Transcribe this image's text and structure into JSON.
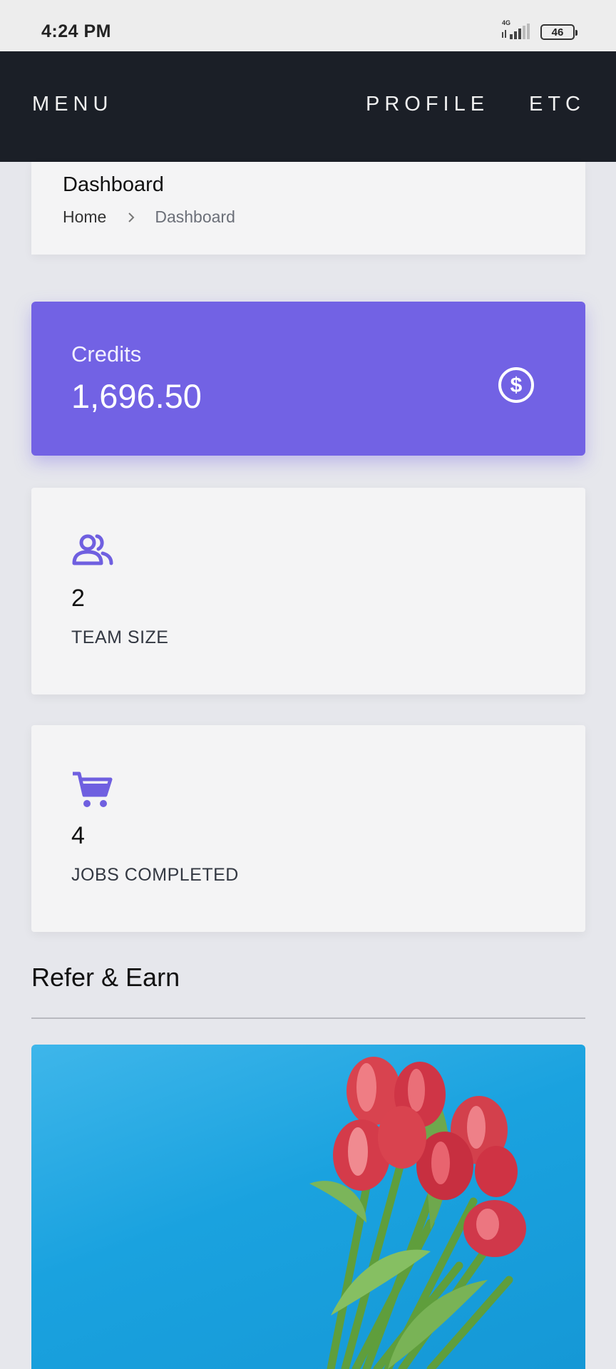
{
  "status_bar": {
    "time": "4:24 PM",
    "network": "4G",
    "battery": "46"
  },
  "nav": {
    "menu": "MENU",
    "profile": "PROFILE",
    "etc": "ETC"
  },
  "breadcrumb_card": {
    "title": "Dashboard",
    "home": "Home",
    "current": "Dashboard"
  },
  "credits": {
    "label": "Credits",
    "value": "1,696.50",
    "accent_color": "#7262e4",
    "icon": "dollar-circle-icon"
  },
  "stats": [
    {
      "value": "2",
      "label": "TEAM SIZE",
      "icon": "team-icon"
    },
    {
      "value": "4",
      "label": "JOBS COMPLETED",
      "icon": "cart-icon"
    }
  ],
  "refer": {
    "title": "Refer & Earn",
    "image": "tulip-bouquet-image"
  }
}
